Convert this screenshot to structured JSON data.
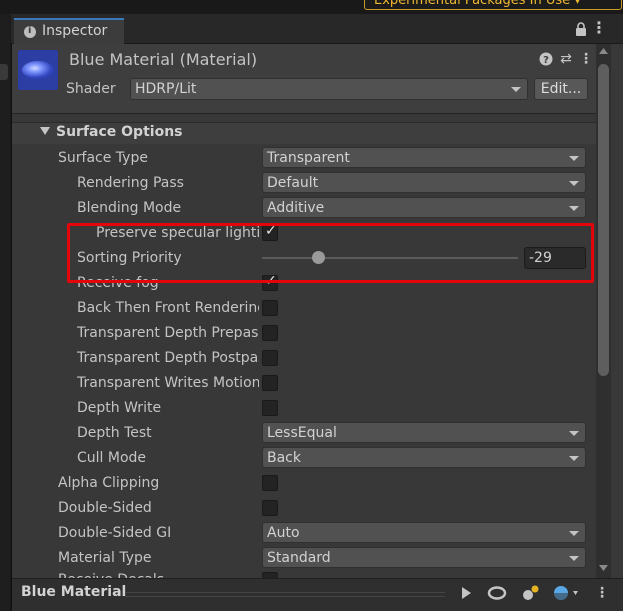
{
  "top": {
    "experimental_badge": "Experimental Packages In Use ▾"
  },
  "tab": {
    "label": "Inspector",
    "menu_glyph": "⋮"
  },
  "header": {
    "material_title": "Blue Material (Material)",
    "help_glyph": "?",
    "settings_glyph": "⇄",
    "menu_glyph": "⋮",
    "shader_label": "Shader",
    "shader_value": "HDRP/Lit",
    "edit_label": "Edit..."
  },
  "section": {
    "title": "Surface Options"
  },
  "rows": [
    {
      "label": "Surface Type",
      "value": "Transparent"
    },
    {
      "label": "Rendering Pass",
      "value": "Default"
    },
    {
      "label": "Blending Mode",
      "value": "Additive"
    },
    {
      "label": "Preserve specular lighting",
      "checked": true
    },
    {
      "label": "Sorting Priority",
      "value": "-29",
      "slider_fraction": 0.22
    },
    {
      "label": "Receive fog",
      "checked": true
    },
    {
      "label": "Back Then Front Rendering",
      "checked": false
    },
    {
      "label": "Transparent Depth Prepass",
      "checked": false
    },
    {
      "label": "Transparent Depth Postpass",
      "checked": false
    },
    {
      "label": "Transparent Writes Motion Vectors",
      "checked": false
    },
    {
      "label": "Depth Write",
      "checked": false
    },
    {
      "label": "Depth Test",
      "value": "LessEqual"
    },
    {
      "label": "Cull Mode",
      "value": "Back"
    },
    {
      "label": "Alpha Clipping",
      "checked": false
    },
    {
      "label": "Double-Sided",
      "checked": false
    },
    {
      "label": "Double-Sided GI",
      "value": "Auto"
    },
    {
      "label": "Material Type",
      "value": "Standard"
    },
    {
      "label": "Receive Decals",
      "checked": false
    }
  ],
  "bottom": {
    "title": "Blue Material",
    "menu_glyph": "⋮"
  },
  "colors": {
    "highlight": "#e3050b",
    "tab_accent": "#3a79bb",
    "badge": "#f0b830"
  }
}
